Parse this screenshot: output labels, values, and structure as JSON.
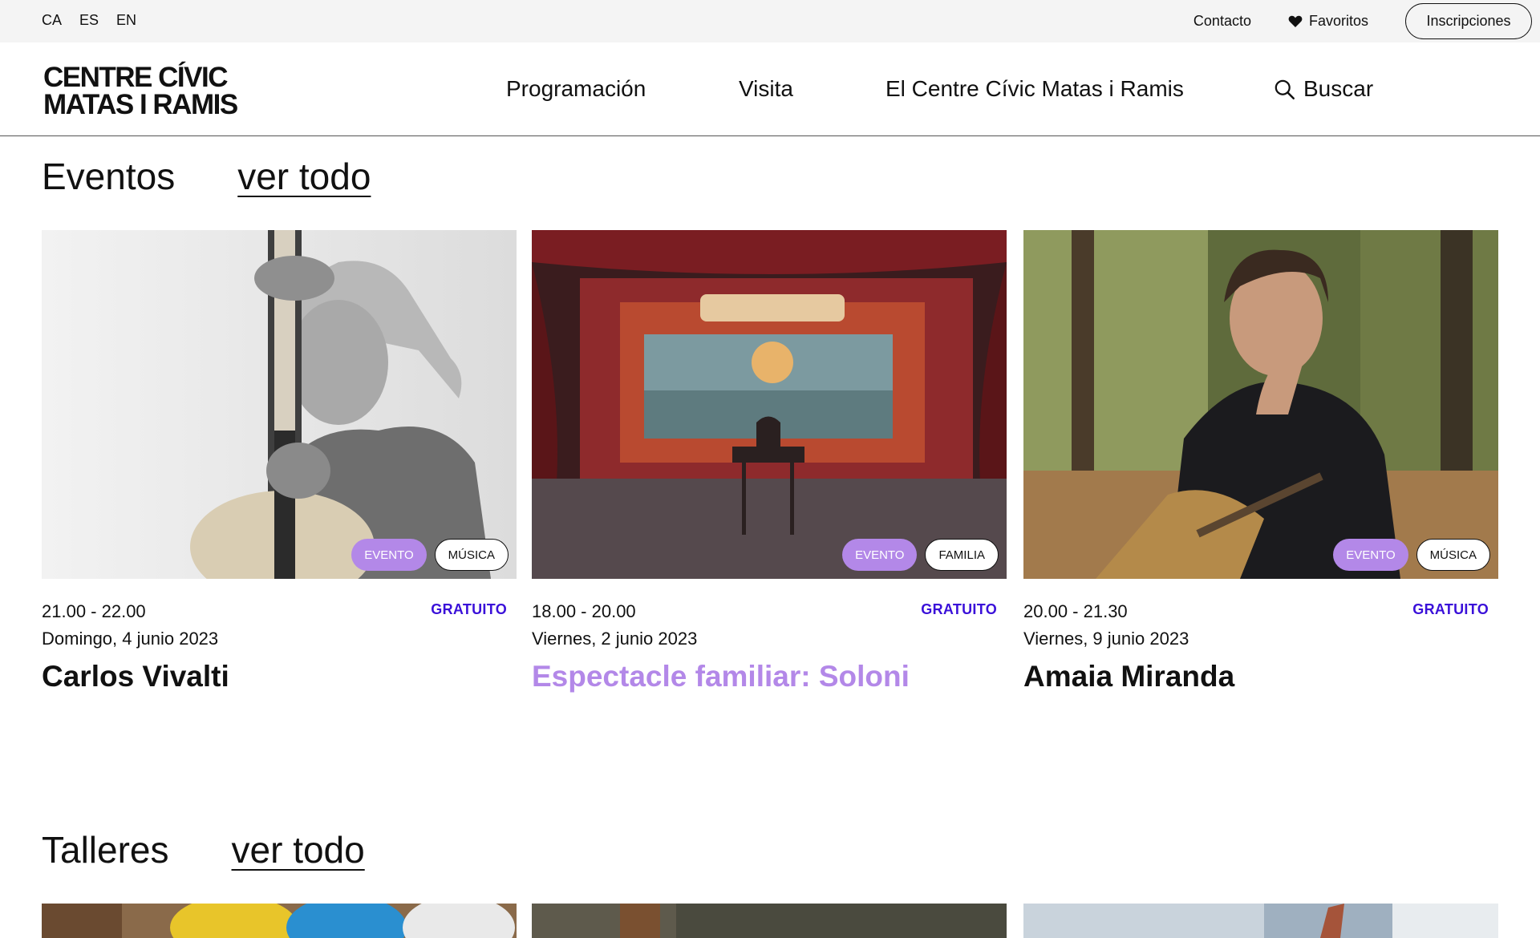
{
  "topbar": {
    "languages": [
      "CA",
      "ES",
      "EN"
    ],
    "contacto": "Contacto",
    "favoritos": "Favoritos",
    "inscripciones": "Inscripciones"
  },
  "header": {
    "logo_line1": "CENTRE CÍVIC",
    "logo_line2": "MATAS I RAMIS",
    "nav": {
      "programacion": "Programación",
      "visita": "Visita",
      "centre": "El Centre Cívic Matas i Ramis",
      "buscar": "Buscar"
    }
  },
  "eventos": {
    "title": "Eventos",
    "ver_todo": "ver todo",
    "cards": [
      {
        "tag": "EVENTO",
        "category": "MÚSICA",
        "time": "21.00 - 22.00",
        "date": "Domingo, 4 junio 2023",
        "price": "GRATUITO",
        "title": "Carlos Vivalti"
      },
      {
        "tag": "EVENTO",
        "category": "FAMILIA",
        "time": "18.00 - 20.00",
        "date": "Viernes, 2 junio 2023",
        "price": "GRATUITO",
        "title": "Espectacle familiar: Soloni"
      },
      {
        "tag": "EVENTO",
        "category": "MÚSICA",
        "time": "20.00 - 21.30",
        "date": "Viernes, 9 junio 2023",
        "price": "GRATUITO",
        "title": "Amaia Miranda"
      }
    ]
  },
  "talleres": {
    "title": "Talleres",
    "ver_todo": "ver todo"
  },
  "colors": {
    "accent_purple": "#b388e8",
    "price_blue": "#3a10d9",
    "topbar_bg": "#f4f4f4"
  },
  "icons": [
    "heart-icon",
    "search-icon"
  ]
}
